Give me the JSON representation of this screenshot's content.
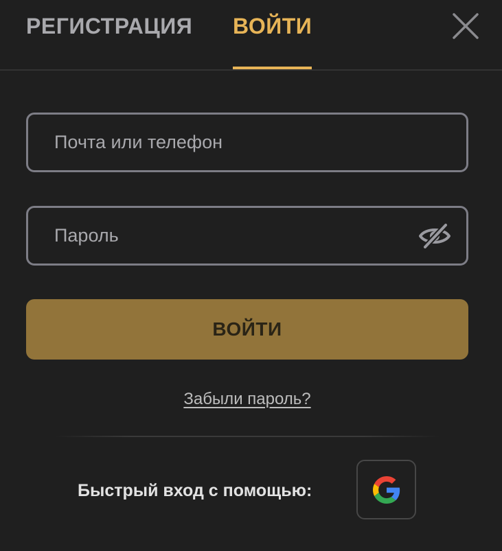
{
  "tabs": {
    "register_label": "РЕГИСТРАЦИЯ",
    "login_label": "ВОЙТИ",
    "active": "login"
  },
  "close_icon": "close-icon",
  "form": {
    "email_placeholder": "Почта или телефон",
    "email_value": "",
    "password_placeholder": "Пароль",
    "password_value": "",
    "password_toggle_icon": "eye-off-icon",
    "submit_label": "ВОЙТИ",
    "forgot_link": "Забыли пароль?"
  },
  "social": {
    "label": "Быстрый вход с помощью:",
    "providers": [
      {
        "name": "Google",
        "icon": "google-icon"
      }
    ]
  },
  "colors": {
    "background": "#1f1f1f",
    "accent": "#e7b457",
    "button_bg": "#92743a",
    "input_border": "#7d7d86",
    "muted_text": "#a9a9ad"
  }
}
